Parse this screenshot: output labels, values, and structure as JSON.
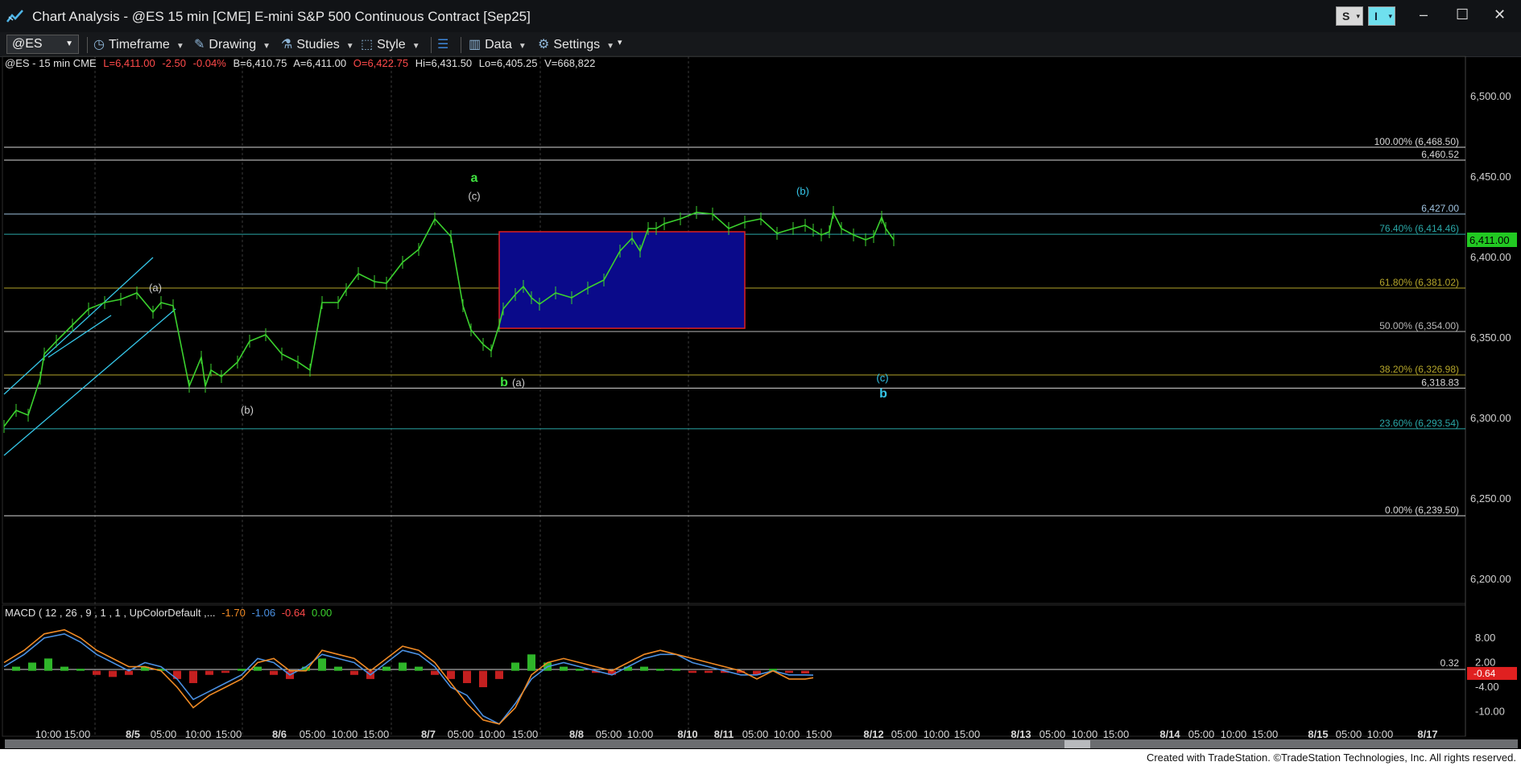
{
  "window": {
    "title": "Chart Analysis - @ES 15 min [CME] E-mini S&P 500 Continuous Contract [Sep25]",
    "s_button": "S",
    "i_button": "I",
    "minimize": "–",
    "maximize": "☐",
    "close": "✕"
  },
  "toolbar": {
    "symbol": "@ES",
    "timeframe": "Timeframe",
    "drawing": "Drawing",
    "studies": "Studies",
    "style": "Style",
    "data": "Data",
    "settings": "Settings"
  },
  "info": {
    "symbol": "@ES - 15 min  CME",
    "last": "L=6,411.00",
    "change": "-2.50",
    "pct": "-0.04%",
    "bid": "B=6,410.75",
    "ask": "A=6,411.00",
    "open": "O=6,422.75",
    "high": "Hi=6,431.50",
    "low": "Lo=6,405.25",
    "volume": "V=668,822"
  },
  "colors": {
    "background": "#000000",
    "price_up": "#3bd12e",
    "negative": "#ff4a4a",
    "box_fill": "#0a0a8a",
    "box_border": "#e02020",
    "fib_line": "#2aa8a8",
    "wave_label": "#d0d0d0",
    "wave_green": "#3fe03f",
    "wave_cyan": "#35c6e8",
    "macd_line": "#4a90e2",
    "signal_line": "#f08a24",
    "last_price_tag": "#22c922"
  },
  "chart_data": [
    {
      "type": "line",
      "title": "@ES - 15 min  CME",
      "ylim": [
        6185,
        6525
      ],
      "y_ticks": [
        6200,
        6250,
        6300,
        6350,
        6400,
        6450,
        6500
      ],
      "y_tick_labels": [
        "6,200.00",
        "6,250.00",
        "6,300.00",
        "6,350.00",
        "6,400.00",
        "6,450.00",
        "6,500.00"
      ],
      "x_labels": [
        "10:00",
        "15:00",
        "8/5",
        "05:00",
        "10:00",
        "15:00",
        "8/6",
        "05:00",
        "10:00",
        "15:00",
        "8/7",
        "05:00",
        "10:00",
        "15:00",
        "8/8",
        "05:00",
        "10:00",
        "8/10",
        "8/11",
        "05:00",
        "10:00",
        "15:00",
        "8/12",
        "05:00",
        "10:00",
        "15:00",
        "8/13",
        "05:00",
        "10:00",
        "15:00",
        "8/14",
        "05:00",
        "10:00",
        "15:00",
        "8/15",
        "05:00",
        "10:00",
        "8/17"
      ],
      "x_range": [
        0,
        1888
      ],
      "x_label_positions": [
        60,
        96,
        165,
        203,
        246,
        284,
        347,
        388,
        428,
        467,
        532,
        572,
        611,
        652,
        716,
        756,
        795,
        854,
        899,
        938,
        977,
        1017,
        1085,
        1123,
        1163,
        1201,
        1268,
        1307,
        1347,
        1386,
        1453,
        1492,
        1532,
        1571,
        1637,
        1675,
        1714,
        1773
      ],
      "series": [
        {
          "color": "#3bd12e",
          "x": [
            5,
            20,
            35,
            50,
            55,
            70,
            90,
            110,
            130,
            150,
            170,
            190,
            200,
            215,
            235,
            250,
            255,
            262,
            275,
            295,
            310,
            330,
            350,
            370,
            385,
            400,
            420,
            430,
            445,
            465,
            480,
            500,
            520,
            540,
            560,
            575,
            585,
            600,
            610,
            620,
            625,
            640,
            650,
            660,
            670,
            690,
            710,
            730,
            750,
            770,
            785,
            795,
            805,
            815,
            825,
            845,
            865,
            885,
            905,
            925,
            945,
            965,
            985,
            1000,
            1010,
            1020,
            1030,
            1035,
            1045,
            1060,
            1075,
            1085,
            1095,
            1100,
            1110
          ],
          "y": [
            6295,
            6305,
            6302,
            6325,
            6340,
            6348,
            6358,
            6368,
            6372,
            6374,
            6378,
            6366,
            6372,
            6370,
            6320,
            6338,
            6320,
            6330,
            6326,
            6335,
            6348,
            6352,
            6340,
            6335,
            6330,
            6372,
            6372,
            6380,
            6390,
            6385,
            6384,
            6397,
            6405,
            6424,
            6413,
            6370,
            6355,
            6346,
            6342,
            6358,
            6368,
            6377,
            6382,
            6375,
            6371,
            6378,
            6375,
            6381,
            6386,
            6404,
            6412,
            6404,
            6418,
            6418,
            6421,
            6424,
            6428,
            6427,
            6418,
            6422,
            6424,
            6415,
            6418,
            6420,
            6417,
            6414,
            6416,
            6428,
            6418,
            6414,
            6411,
            6413,
            6425,
            6418,
            6411
          ]
        }
      ],
      "last_price": "6,411.00",
      "levels": [
        {
          "value": 6468.5,
          "label": "100.00% (6,468.50)",
          "color": "#d8d8d8"
        },
        {
          "value": 6460.52,
          "label": "6,460.52",
          "color": "#d8d8d8"
        },
        {
          "value": 6427.0,
          "label": "6,427.00",
          "color": "#9fc3e0"
        },
        {
          "value": 6414.46,
          "label": "76.40% (6,414.46)",
          "color": "#2aa8a8"
        },
        {
          "value": 6381.02,
          "label": "61.80% (6,381.02)",
          "color": "#b4a52a"
        },
        {
          "value": 6354.0,
          "label": "50.00% (6,354.00)",
          "color": "#b8b8b8"
        },
        {
          "value": 6326.98,
          "label": "38.20% (6,326.98)",
          "color": "#b4a52a"
        },
        {
          "value": 6318.83,
          "label": "6,318.83",
          "color": "#d8d8d8"
        },
        {
          "value": 6293.54,
          "label": "23.60% (6,293.54)",
          "color": "#2aa8a8"
        },
        {
          "value": 6239.5,
          "label": "0.00% (6,239.50)",
          "color": "#d8d8d8"
        }
      ],
      "annotations": [
        {
          "text": "(a)",
          "x": 193,
          "y": 6379,
          "color": "#d0d0d0"
        },
        {
          "text": "(b)",
          "x": 307,
          "y": 6303,
          "color": "#d0d0d0"
        },
        {
          "text": "a",
          "x": 589,
          "y": 6447,
          "color": "#3fe03f"
        },
        {
          "text": "(c)",
          "x": 589,
          "y": 6436,
          "color": "#d0d0d0"
        },
        {
          "text": "b",
          "x": 626,
          "y": 6320,
          "color": "#3fe03f"
        },
        {
          "text": "(a)",
          "x": 644,
          "y": 6320,
          "color": "#d0d0d0"
        },
        {
          "text": "(b)",
          "x": 997,
          "y": 6439,
          "color": "#35c6e8"
        },
        {
          "text": "(c)",
          "x": 1096,
          "y": 6323,
          "color": "#35c6e8"
        },
        {
          "text": "b",
          "x": 1097,
          "y": 6313,
          "color": "#35c6e8"
        }
      ],
      "box": {
        "x0": 620,
        "x1": 925,
        "y0": 6356,
        "y1": 6416
      }
    },
    {
      "type": "line",
      "title": "MACD",
      "ylim": [
        -14,
        12.5
      ],
      "y_ticks": [
        8,
        2,
        -4,
        -10
      ],
      "y_tick_labels": [
        "8.00",
        "2.00",
        "-4.00",
        "-10.00"
      ],
      "values_readout": [
        "-1.70",
        "-1.06",
        "-0.64",
        "0.00"
      ],
      "zero_line_label": "0.32",
      "last_value_tag": "-0.64",
      "series": [
        {
          "name": "MACD",
          "color": "#4a90e2",
          "x": [
            5,
            30,
            55,
            80,
            100,
            120,
            140,
            160,
            180,
            200,
            220,
            240,
            260,
            280,
            300,
            320,
            340,
            360,
            380,
            400,
            420,
            440,
            460,
            480,
            500,
            520,
            540,
            560,
            580,
            600,
            620,
            640,
            660,
            680,
            700,
            720,
            740,
            760,
            780,
            800,
            820,
            840,
            860,
            880,
            900,
            920,
            940,
            960,
            980,
            1000,
            1010
          ],
          "y": [
            1,
            4,
            8,
            9,
            7,
            4,
            2,
            0,
            2,
            1,
            -2,
            -7,
            -5,
            -3,
            -1,
            3,
            2,
            -1,
            1,
            4,
            3,
            2,
            -1,
            2,
            5,
            4,
            1,
            -4,
            -6,
            -11,
            -13,
            -8,
            -2,
            1,
            2,
            1,
            0,
            -1,
            1,
            3,
            4,
            4,
            2,
            1,
            0,
            -1,
            -1,
            0,
            -1,
            -1,
            -1.06
          ]
        },
        {
          "name": "Signal",
          "color": "#f08a24",
          "x": [
            5,
            30,
            55,
            80,
            100,
            120,
            140,
            160,
            180,
            200,
            220,
            240,
            260,
            280,
            300,
            320,
            340,
            360,
            380,
            400,
            420,
            440,
            460,
            480,
            500,
            520,
            540,
            560,
            580,
            600,
            620,
            640,
            660,
            680,
            700,
            720,
            740,
            760,
            780,
            800,
            820,
            840,
            860,
            880,
            900,
            920,
            940,
            960,
            980,
            1000,
            1010
          ],
          "y": [
            2,
            5,
            9,
            10,
            8,
            5,
            3,
            1,
            1,
            0,
            -4,
            -9,
            -6,
            -4,
            -2,
            2,
            3,
            0,
            0,
            5,
            4,
            3,
            0,
            3,
            6,
            5,
            2,
            -3,
            -8,
            -12,
            -13,
            -9,
            -1,
            2,
            3,
            2,
            1,
            0,
            2,
            4,
            5,
            4,
            3,
            2,
            1,
            0,
            -2,
            0,
            -2,
            -2,
            -1.7
          ]
        },
        {
          "name": "Histogram",
          "color": "#3bd12e",
          "x": [
            20,
            40,
            60,
            80,
            100,
            120,
            140,
            160,
            180,
            200,
            220,
            240,
            260,
            280,
            300,
            320,
            340,
            360,
            380,
            400,
            420,
            440,
            460,
            480,
            500,
            520,
            540,
            560,
            580,
            600,
            620,
            640,
            660,
            680,
            700,
            720,
            740,
            760,
            780,
            800,
            820,
            840,
            860,
            880,
            900,
            920,
            940,
            960,
            980,
            1000
          ],
          "y": [
            1,
            2,
            3,
            1,
            0.5,
            -1,
            -1.5,
            -1,
            1,
            0.5,
            -2,
            -3,
            -1,
            -0.5,
            0.5,
            1,
            -1,
            -2,
            1,
            3,
            1,
            -1,
            -2,
            1,
            2,
            1,
            -1,
            -2,
            -3,
            -4,
            -2,
            2,
            4,
            2,
            1,
            0.5,
            -0.5,
            -1,
            1,
            1,
            0.5,
            0.5,
            -0.5,
            -0.5,
            -0.5,
            -0.5,
            -1,
            0.5,
            -0.5,
            -0.64
          ]
        }
      ]
    }
  ],
  "macd_header": {
    "label": "MACD ( 12 , 26 , 9 , 1 , 1 , UpColorDefault ,...",
    "v1": "-1.70",
    "v2": "-1.06",
    "v3": "-0.64",
    "v4": "0.00"
  },
  "footer": "Created with TradeStation. ©TradeStation Technologies, Inc. All rights reserved."
}
